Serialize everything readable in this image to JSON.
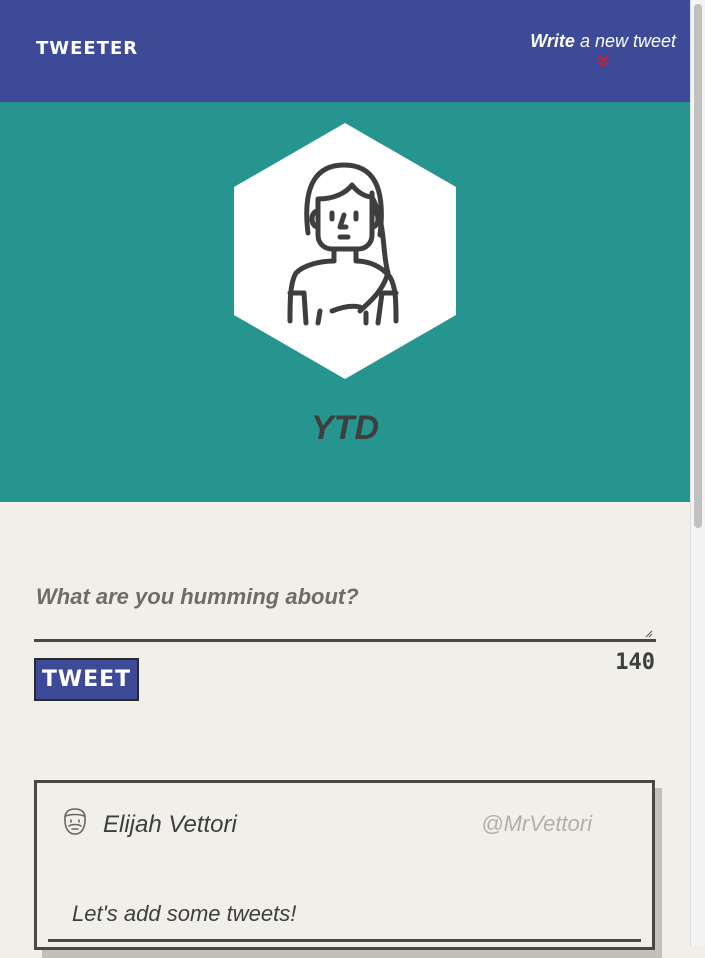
{
  "nav": {
    "brand": "TWEETER",
    "compose_toggle_strong": "Write",
    "compose_toggle_rest": " a new tweet",
    "chevron_icon": "double-chevron-down-icon",
    "chevron_color": "#c0233c"
  },
  "profile": {
    "avatar_icon": "woman-avatar-icon",
    "name": "YTD"
  },
  "compose": {
    "placeholder": "What are you humming about?",
    "value": "",
    "button_label": "TWEET",
    "counter": "140"
  },
  "tweets": [
    {
      "avatar_icon": "bearded-man-avatar-icon",
      "name": "Elijah Vettori",
      "handle": "@MrVettori",
      "text": "Let's add some tweets!"
    }
  ],
  "colors": {
    "nav": "#3d4a98",
    "profile": "#27958f",
    "background": "#f1efea",
    "text": "#3e3e3e"
  }
}
